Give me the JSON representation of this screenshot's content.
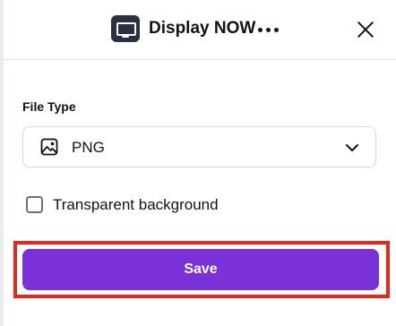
{
  "header": {
    "app_icon": "monitor-icon",
    "title": "Display NOW",
    "more_icon": "more-horizontal-icon",
    "close_icon": "close-icon"
  },
  "file_type": {
    "label": "File Type",
    "selected_value": "PNG",
    "value_icon": "image-icon",
    "dropdown_icon": "chevron-down-icon"
  },
  "transparent_background": {
    "label": "Transparent background",
    "checked": false
  },
  "actions": {
    "save_label": "Save"
  },
  "colors": {
    "accent": "#7a31d8",
    "highlight": "#e8261c",
    "text": "#0e1318",
    "app_icon_bg": "#2a3040"
  }
}
